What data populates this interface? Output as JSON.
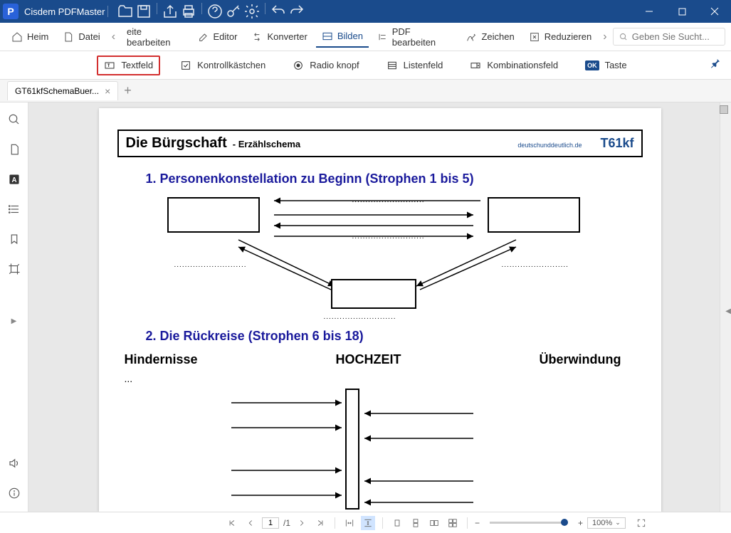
{
  "app": {
    "title": "Cisdem PDFMaster"
  },
  "menu": {
    "heim": "Heim",
    "datei": "Datei",
    "eite": "eite bearbeiten",
    "editor": "Editor",
    "konverter": "Konverter",
    "bilden": "Bilden",
    "pdfbearbeiten": "PDF bearbeiten",
    "zeichen": "Zeichen",
    "reduzieren": "Reduzieren",
    "search_placeholder": "Geben Sie Sucht..."
  },
  "formbar": {
    "textfeld": "Textfeld",
    "kontroll": "Kontrollkästchen",
    "radio": "Radio knopf",
    "listenfeld": "Listenfeld",
    "kombi": "Kombinationsfeld",
    "taste": "Taste",
    "ok": "OK"
  },
  "tab": {
    "name": "GT61kfSchemaBuer..."
  },
  "doc": {
    "title": "Die Bürgschaft",
    "subtitle": "- Erzählschema",
    "url": "deutschunddeutlich.de",
    "code": "T61kf",
    "section1": "1. Personenkonstellation zu Beginn (Strophen 1 bis 5)",
    "section2": "2. Die Rückreise (Strophen 6 bis 18)",
    "col1": "Hindernisse",
    "col2": "HOCHZEIT",
    "col3": "Überwindung",
    "ellipsis": "..."
  },
  "status": {
    "page_current": "1",
    "page_total": "/1",
    "zoom": "100%"
  }
}
